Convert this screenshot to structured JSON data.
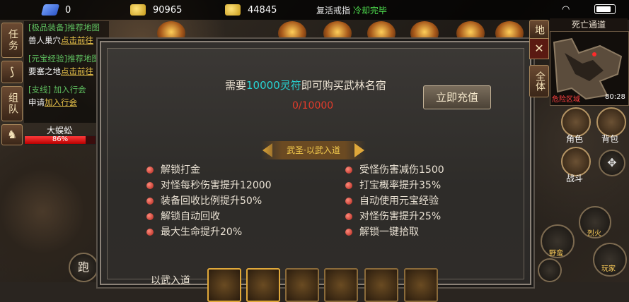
{
  "top_bar": {
    "gem_count": "0",
    "gold_count": "90965",
    "ingot_count": "44845",
    "status_prefix": "复活戒指",
    "status_suffix": "冷却完毕"
  },
  "left_panel": {
    "task_button": "任务",
    "team_button": "组队",
    "quests": [
      {
        "title": "[极品装备]推荐地图",
        "desc": "兽人巢穴",
        "link": "点击前往"
      },
      {
        "title": "[元宝经验]推荐地图",
        "desc": "要塞之地",
        "link": "点击前往"
      },
      {
        "title": "[支线]",
        "title_link": "加入行会",
        "desc": "申请",
        "link": "加入行会"
      }
    ],
    "boss_name": "大蜈蚣",
    "boss_hp_text": "86%",
    "boss_hp_fraction": 0.86
  },
  "modal": {
    "need_prefix": "需要",
    "need_amount": "10000灵符",
    "need_suffix": "即可购买武林名宿",
    "progress_text": "0/10000",
    "recharge_label": "立即充值",
    "banner_text": "武圣·以武入道",
    "perks_left": [
      "解锁打金",
      "对怪每秒伤害提升12000",
      "装备回收比例提升50%",
      "解锁自动回收",
      "最大生命提升20%"
    ],
    "perks_right": [
      "受怪伤害减伤1500",
      "打宝概率提升35%",
      "自动使用元宝经验",
      "对怪伤害提升25%",
      "解锁一键拾取"
    ],
    "bottom_label": "以武入道"
  },
  "right_panel": {
    "map_button": "地",
    "close_label": "✕",
    "full_button": "全体",
    "map_title": "死亡通道",
    "map_coord": "80:28",
    "map_zone": "危险区域",
    "character_label": "角色",
    "bag_label": "背包",
    "battle_label": "战斗",
    "skill1_label": "烈火",
    "skill2_label": "野蛮",
    "skill3_label": "玩家"
  },
  "run_button": "跑",
  "colors": {
    "highlight_cyan": "#27d4d4",
    "counter_red": "#e23b2b",
    "quest_green": "#5fbf5f",
    "link_gold": "#e8c24a",
    "hp_red": "#d81a1a"
  }
}
